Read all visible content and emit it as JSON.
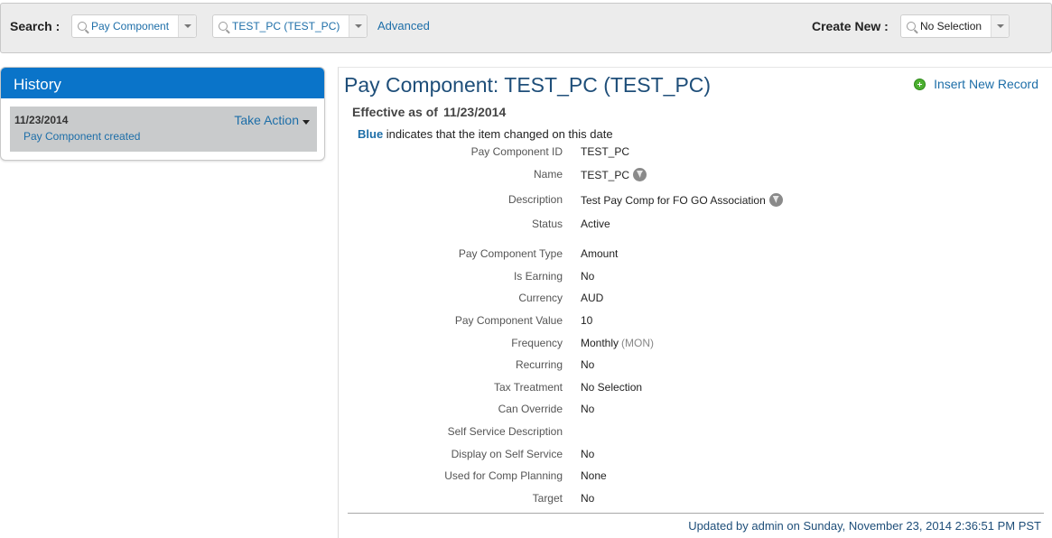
{
  "search": {
    "label": "Search :",
    "type_value": "Pay Component",
    "record_value": "TEST_PC (TEST_PC)",
    "advanced": "Advanced"
  },
  "create_new": {
    "label": "Create New :",
    "value": "No Selection"
  },
  "history": {
    "title": "History",
    "item_date": "11/23/2014",
    "item_desc": "Pay Component created",
    "take_action": "Take Action"
  },
  "main": {
    "title": "Pay Component: TEST_PC (TEST_PC)",
    "insert_new": "Insert New Record",
    "effective_label": "Effective as of",
    "effective_date": "11/23/2014",
    "legend_word": "Blue",
    "legend_text": "indicates that the item changed on this date",
    "fields": [
      {
        "label": "Pay Component ID",
        "value": "TEST_PC"
      },
      {
        "label": "Name",
        "value": "TEST_PC"
      },
      {
        "label": "Description",
        "value": "Test Pay Comp for FO GO Association"
      },
      {
        "label": "Status",
        "value": "Active"
      },
      {
        "label": "Pay Component Type",
        "value": "Amount"
      },
      {
        "label": "Is Earning",
        "value": "No"
      },
      {
        "label": "Currency",
        "value": "AUD"
      },
      {
        "label": "Pay Component Value",
        "value": "10"
      },
      {
        "label": "Frequency",
        "value": "Monthly",
        "extra": "(MON)"
      },
      {
        "label": "Recurring",
        "value": "No"
      },
      {
        "label": "Tax Treatment",
        "value": "No Selection"
      },
      {
        "label": "Can Override",
        "value": "No"
      },
      {
        "label": "Self Service Description",
        "value": ""
      },
      {
        "label": "Display on Self Service",
        "value": "No"
      },
      {
        "label": "Used for Comp Planning",
        "value": "None"
      },
      {
        "label": "Target",
        "value": "No"
      }
    ],
    "footer": "Updated by admin on Sunday, November 23, 2014 2:36:51 PM PST"
  },
  "icons": {
    "search_field": "search-icon",
    "dropdown": "chevron-down-icon",
    "insert": "add-circle-icon",
    "translation": "globe-icon"
  },
  "colors": {
    "accent": "#0a74c9",
    "link": "#1d6ea8",
    "title": "#1e4e79",
    "insert_icon": "#4caf30"
  }
}
